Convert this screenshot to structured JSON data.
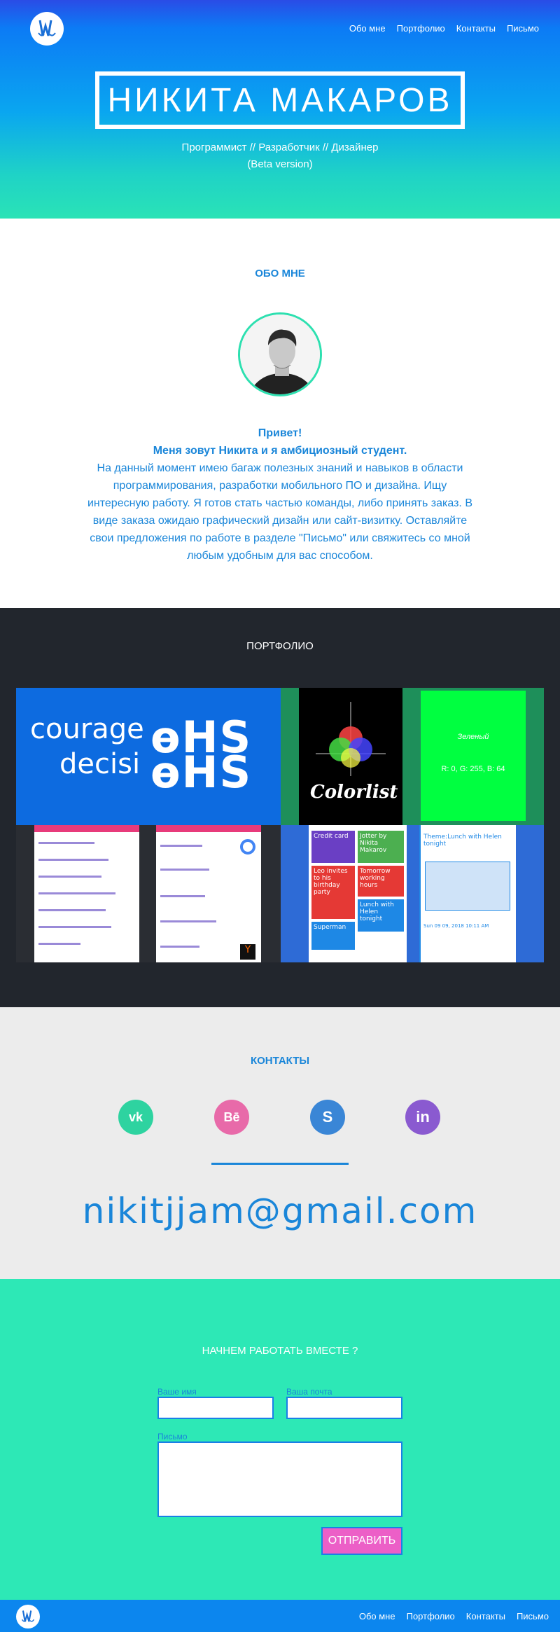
{
  "nav": {
    "about": "Обо мне",
    "portfolio": "Портфолио",
    "contacts": "Контакты",
    "letter": "Письмо"
  },
  "hero": {
    "name": "НИКИТА МАКАРОВ",
    "roles": "Программист // Разработчик // Дизайнер",
    "version": "(Beta version)"
  },
  "about": {
    "title": "ОБО МНЕ",
    "greeting": "Привет!",
    "intro": "Меня зовут Никита и я амбициозный студент.",
    "body": "На данный момент имею багаж полезных знаний и навыков в области программирования, разработки мобильного ПО и дизайна. Ищу интересную работу. Я готов стать частью команды, либо принять заказ. В виде заказа ожидаю графический дизайн или сайт-визитку. Оставляйте свои предложения по работе в разделе \"Письмо\" или свяжитесь со мной любым удобным для вас способом."
  },
  "portfolio": {
    "title": "ПОРТФОЛИО",
    "tile1": {
      "word1": "courage",
      "word2": "decisi",
      "glyphs": "ɵHS"
    },
    "tile2": {
      "app_name": "Colorlist",
      "color_name": "Зеленый",
      "rgb": "R: 0, G: 255, B: 64"
    },
    "tile4": {
      "notes": [
        "Credit card",
        "Jotter by Nikita Makarov",
        "Leo invites to his birthday party",
        "Tomorrow working hours",
        "Superman",
        "Lunch with Helen tonight"
      ],
      "detail_title": "Theme:Lunch with Helen tonight",
      "detail_date": "Sun 09 09, 2018 10:11 AM"
    }
  },
  "contacts": {
    "title": "КОНТАКТЫ",
    "social": [
      {
        "name": "vk",
        "label": "vk",
        "color": "#2ed3a0"
      },
      {
        "name": "behance",
        "label": "Bē",
        "color": "#e86aa9"
      },
      {
        "name": "skype",
        "label": "S",
        "color": "#3a86d6"
      },
      {
        "name": "linkedin",
        "label": "in",
        "color": "#8a5ad0"
      }
    ],
    "email": "nikitjjam@gmail.com"
  },
  "form": {
    "title": "НАЧНЕМ РАБОТАТЬ ВМЕСТЕ ?",
    "name_label": "Ваше имя",
    "email_label": "Ваша почта",
    "message_label": "Письмо",
    "send_label": "ОТПРАВИТЬ"
  },
  "colors": {
    "accent": "#1a86d9",
    "teal": "#2de8b6",
    "dark": "#22262d",
    "button": "#ec5fc7"
  }
}
